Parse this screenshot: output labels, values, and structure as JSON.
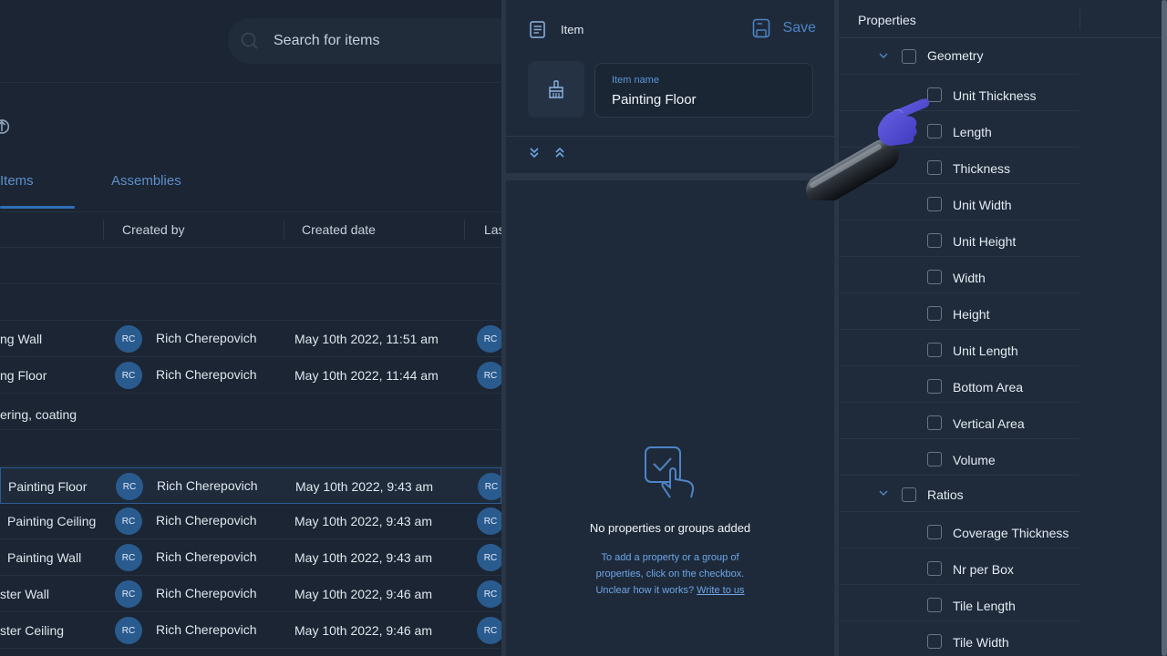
{
  "list_panel": {
    "search": {
      "placeholder": "Search for items"
    },
    "tabs": {
      "items": "Items",
      "assemblies": "Assemblies"
    },
    "columns": {
      "created_by": "Created by",
      "created_date": "Created date",
      "last": "Las"
    },
    "rows": [
      {
        "name": "ng Wall",
        "initials": "RC",
        "creator": "Rich Cherepovich",
        "date": "May 10th 2022, 11:51 am",
        "initials2": "RC"
      },
      {
        "name": "ng Floor",
        "initials": "RC",
        "creator": "Rich Cherepovich",
        "date": "May 10th 2022, 11:44 am",
        "initials2": "RC"
      }
    ],
    "group_label": "ering, coating",
    "rows2": [
      {
        "name": "Painting Floor",
        "initials": "RC",
        "creator": "Rich Cherepovich",
        "date": "May 10th 2022, 9:43 am",
        "initials2": "RC"
      },
      {
        "name": "Painting Ceiling",
        "initials": "RC",
        "creator": "Rich Cherepovich",
        "date": "May 10th 2022, 9:43 am",
        "initials2": "RC"
      },
      {
        "name": "Painting Wall",
        "initials": "RC",
        "creator": "Rich Cherepovich",
        "date": "May 10th 2022, 9:43 am",
        "initials2": "RC"
      },
      {
        "name": "ster Wall",
        "initials": "RC",
        "creator": "Rich Cherepovich",
        "date": "May 10th 2022, 9:46 am",
        "initials2": "RC"
      },
      {
        "name": "ster Ceiling",
        "initials": "RC",
        "creator": "Rich Cherepovich",
        "date": "May 10th 2022, 9:46 am",
        "initials2": "RC"
      }
    ]
  },
  "item_panel": {
    "title": "Item",
    "save_label": "Save",
    "name_label": "Item name",
    "name_value": "Painting Floor",
    "empty_title": "No properties or groups added",
    "empty_line1": "To add a property or a group of",
    "empty_line2": "properties, click on the checkbox.",
    "empty_line3": "Unclear how it works?",
    "write_link": "Write to us"
  },
  "properties_panel": {
    "title": "Properties",
    "groups": [
      {
        "label": "Geometry",
        "items": [
          "Unit Thickness",
          "Length",
          "Thickness",
          "Unit Width",
          "Unit Height",
          "Width",
          "Height",
          "Unit Length",
          "Bottom Area",
          "Vertical Area",
          "Volume"
        ]
      },
      {
        "label": "Ratios",
        "items": [
          "Coverage Thickness",
          "Nr per Box",
          "Tile Length",
          "Tile Width"
        ]
      }
    ]
  },
  "colors": {
    "accent": "#4e84c4",
    "avatar": "#2a5b8f",
    "pointer_glove": "#4b45c9"
  }
}
